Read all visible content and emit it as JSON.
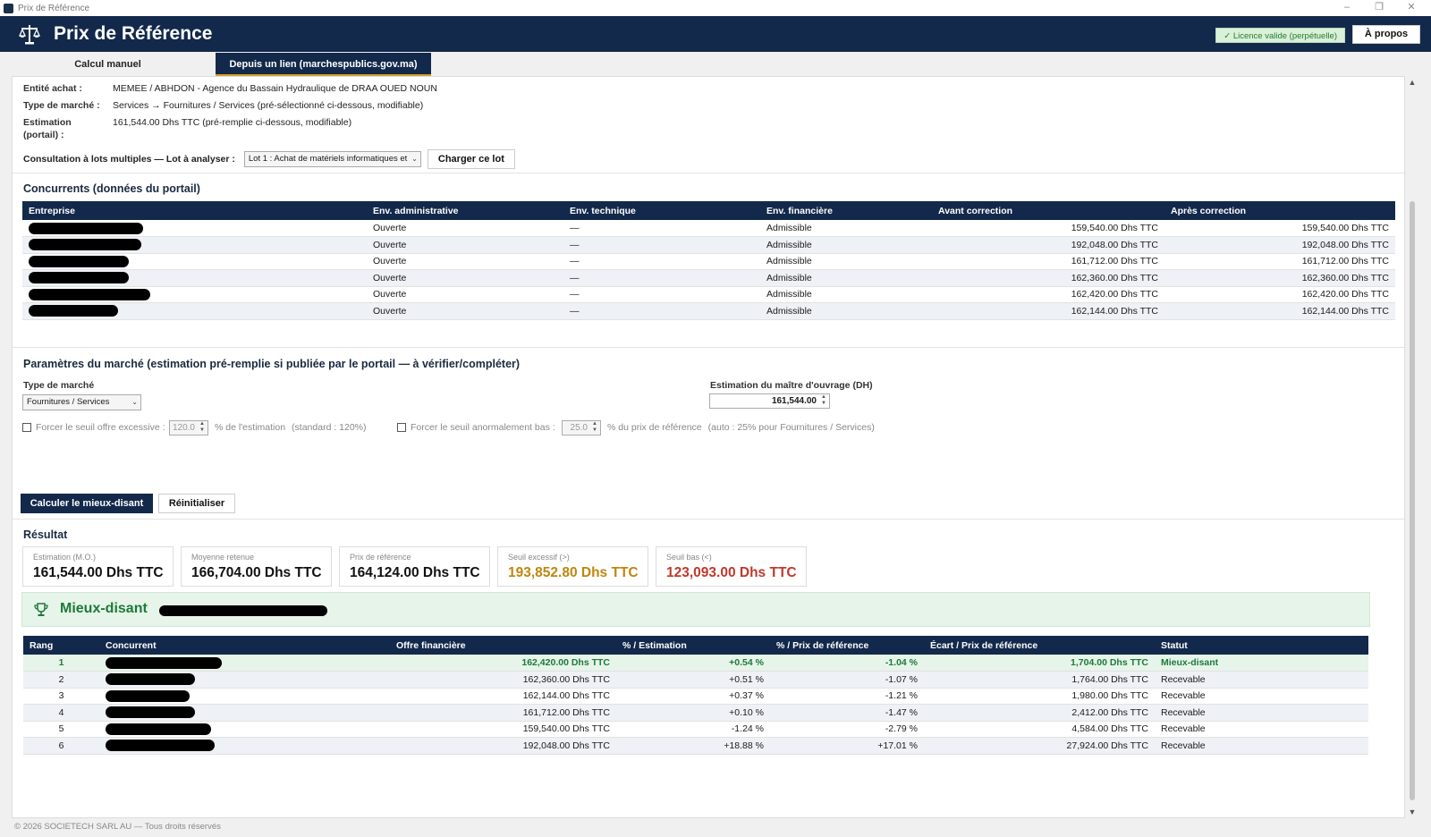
{
  "window": {
    "title": "Prix de Référence",
    "minimize": "–",
    "restore": "❐",
    "close": "✕"
  },
  "header": {
    "title": "Prix de Référence",
    "license": "✓ Licence valide (perpétuelle)",
    "about": "À propos"
  },
  "tabs": [
    {
      "label": "Calcul manuel"
    },
    {
      "label": "Depuis un lien (marchespublics.gov.ma)"
    }
  ],
  "info": {
    "entite_label": "Entité achat :",
    "entite_value": "MEMEE / ABHDON - Agence du Bassain Hydraulique de DRAA OUED NOUN",
    "type_label": "Type de marché :",
    "type_value": "Services → Fournitures / Services (pré-sélectionné ci-dessous, modifiable)",
    "estimation_label_1": "Estimation",
    "estimation_label_2": "(portail) :",
    "estimation_value": "161,544.00 Dhs TTC (pré-remplie ci-dessous, modifiable)",
    "lot_label": "Consultation à lots multiples — Lot à analyser :",
    "lot_select": "Lot 1 : Achat de matériels informatiques et",
    "load_button": "Charger ce lot"
  },
  "concurrents": {
    "title": "Concurrents (données du portail)",
    "columns": [
      "Entreprise",
      "Env. administrative",
      "Env. technique",
      "Env. financière",
      "Avant correction",
      "Après correction"
    ],
    "rows": [
      {
        "admin": "Ouverte",
        "tech": "—",
        "fin": "Admissible",
        "avant": "159,540.00 Dhs TTC",
        "apres": "159,540.00 Dhs TTC"
      },
      {
        "admin": "Ouverte",
        "tech": "—",
        "fin": "Admissible",
        "avant": "192,048.00 Dhs TTC",
        "apres": "192,048.00 Dhs TTC"
      },
      {
        "admin": "Ouverte",
        "tech": "—",
        "fin": "Admissible",
        "avant": "161,712.00 Dhs TTC",
        "apres": "161,712.00 Dhs TTC"
      },
      {
        "admin": "Ouverte",
        "tech": "—",
        "fin": "Admissible",
        "avant": "162,360.00 Dhs TTC",
        "apres": "162,360.00 Dhs TTC"
      },
      {
        "admin": "Ouverte",
        "tech": "—",
        "fin": "Admissible",
        "avant": "162,420.00 Dhs TTC",
        "apres": "162,420.00 Dhs TTC"
      },
      {
        "admin": "Ouverte",
        "tech": "—",
        "fin": "Admissible",
        "avant": "162,144.00 Dhs TTC",
        "apres": "162,144.00 Dhs TTC"
      }
    ]
  },
  "params": {
    "title": "Paramètres du marché (estimation pré-remplie si publiée par le portail — à vérifier/compléter)",
    "type_label": "Type de marché",
    "type_value": "Fournitures / Services",
    "estimation_label": "Estimation du maître d'ouvrage (DH)",
    "estimation_value": "161,544.00",
    "seuil_exc_label": "Forcer le seuil offre excessive :",
    "seuil_exc_value": "120.0",
    "seuil_exc_unit": "% de l'estimation",
    "seuil_exc_hint": "(standard : 120%)",
    "seuil_bas_label": "Forcer le seuil anormalement bas :",
    "seuil_bas_value": "25.0",
    "seuil_bas_unit": "% du prix de référence",
    "seuil_bas_hint": "(auto : 25% pour Fournitures / Services)"
  },
  "actions": {
    "calc": "Calculer le mieux-disant",
    "reset": "Réinitialiser"
  },
  "result": {
    "title": "Résultat",
    "cards": [
      {
        "label": "Estimation (M.O.)",
        "value": "161,544.00 Dhs TTC",
        "color": "#111111"
      },
      {
        "label": "Moyenne retenue",
        "value": "166,704.00 Dhs TTC",
        "color": "#111111"
      },
      {
        "label": "Prix de référence",
        "value": "164,124.00 Dhs TTC",
        "color": "#111111"
      },
      {
        "label": "Seuil excessif (>)",
        "value": "193,852.80 Dhs TTC",
        "color": "#c0860f"
      },
      {
        "label": "Seuil bas (<)",
        "value": "123,093.00 Dhs TTC",
        "color": "#c0392b"
      }
    ],
    "winner_label": "Mieux-disant",
    "columns": [
      "Rang",
      "Concurrent",
      "Offre financière",
      "% / Estimation",
      "% / Prix de référence",
      "Écart / Prix de référence",
      "Statut"
    ],
    "rows": [
      {
        "rang": "1",
        "offre": "162,420.00 Dhs TTC",
        "pest": "+0.54 %",
        "pref": "-1.04 %",
        "ecart": "1,704.00 Dhs TTC",
        "statut": "Mieux-disant"
      },
      {
        "rang": "2",
        "offre": "162,360.00 Dhs TTC",
        "pest": "+0.51 %",
        "pref": "-1.07 %",
        "ecart": "1,764.00 Dhs TTC",
        "statut": "Recevable"
      },
      {
        "rang": "3",
        "offre": "162,144.00 Dhs TTC",
        "pest": "+0.37 %",
        "pref": "-1.21 %",
        "ecart": "1,980.00 Dhs TTC",
        "statut": "Recevable"
      },
      {
        "rang": "4",
        "offre": "161,712.00 Dhs TTC",
        "pest": "+0.10 %",
        "pref": "-1.47 %",
        "ecart": "2,412.00 Dhs TTC",
        "statut": "Recevable"
      },
      {
        "rang": "5",
        "offre": "159,540.00 Dhs TTC",
        "pest": "-1.24 %",
        "pref": "-2.79 %",
        "ecart": "4,584.00 Dhs TTC",
        "statut": "Recevable"
      },
      {
        "rang": "6",
        "offre": "192,048.00 Dhs TTC",
        "pest": "+18.88 %",
        "pref": "+17.01 %",
        "ecart": "27,924.00 Dhs TTC",
        "statut": "Recevable"
      }
    ]
  },
  "footer": "© 2026 SOCIETECH SARL AU — Tous droits réservés"
}
